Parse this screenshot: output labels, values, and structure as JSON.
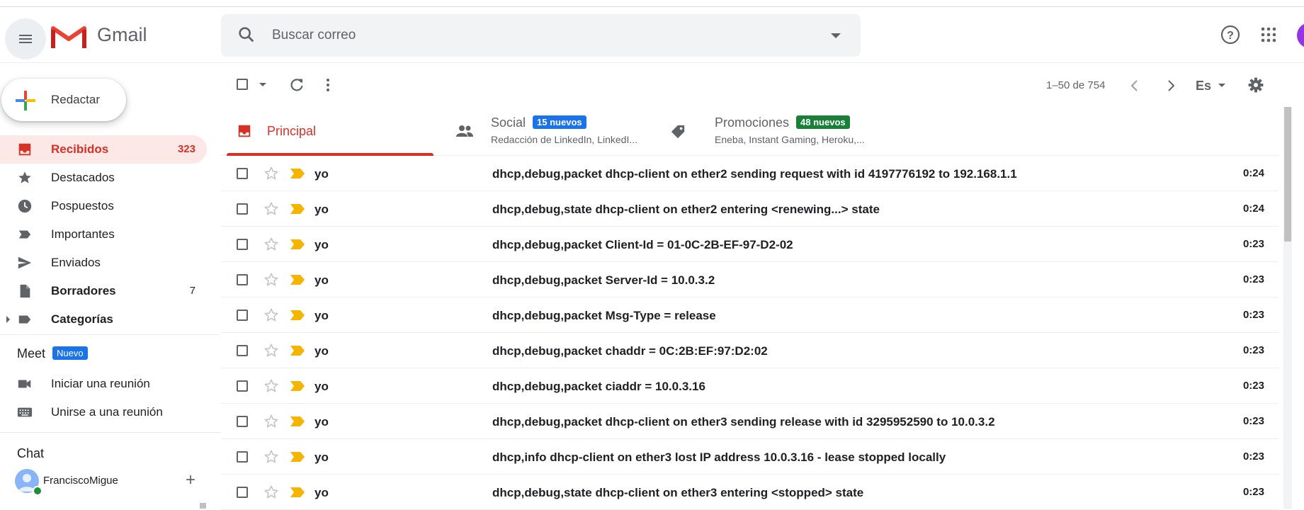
{
  "header": {
    "brand": "Gmail",
    "search_placeholder": "Buscar correo"
  },
  "sidebar": {
    "compose_label": "Redactar",
    "items": [
      {
        "label": "Recibidos",
        "count": "323",
        "icon": "inbox-icon"
      },
      {
        "label": "Destacados",
        "count": "",
        "icon": "star-icon"
      },
      {
        "label": "Pospuestos",
        "count": "",
        "icon": "clock-icon"
      },
      {
        "label": "Importantes",
        "count": "",
        "icon": "label-important-icon"
      },
      {
        "label": "Enviados",
        "count": "",
        "icon": "send-icon"
      },
      {
        "label": "Borradores",
        "count": "7",
        "icon": "draft-icon"
      },
      {
        "label": "Categorías",
        "count": "",
        "icon": "label-icon"
      }
    ],
    "meet": {
      "title": "Meet",
      "badge": "Nuevo",
      "items": [
        {
          "label": "Iniciar una reunión",
          "icon": "video-icon"
        },
        {
          "label": "Unirse a una reunión",
          "icon": "keyboard-icon"
        }
      ]
    },
    "chat": {
      "title": "Chat",
      "user": "FranciscoMigue"
    }
  },
  "toolbar": {
    "pager": "1–50 de 754",
    "language": "Es"
  },
  "tabs": [
    {
      "title": "Principal",
      "chip": "",
      "subtitle": ""
    },
    {
      "title": "Social",
      "chip": "15 nuevos",
      "subtitle": "Redacción de LinkedIn, LinkedI..."
    },
    {
      "title": "Promociones",
      "chip": "48 nuevos",
      "subtitle": "Eneba, Instant Gaming, Heroku,..."
    }
  ],
  "colors": {
    "accent_red": "#d93025",
    "social_chip": "#1a73e8",
    "promo_chip": "#188038",
    "important_marker": "#f4b400"
  },
  "emails": [
    {
      "sender": "yo",
      "subject": "dhcp,debug,packet dhcp-client on ether2 sending request with id 4197776192 to 192.168.1.1",
      "time": "0:24"
    },
    {
      "sender": "yo",
      "subject": "dhcp,debug,state dhcp-client on ether2 entering <renewing...> state",
      "time": "0:24"
    },
    {
      "sender": "yo",
      "subject": "dhcp,debug,packet Client-Id = 01-0C-2B-EF-97-D2-02",
      "time": "0:23"
    },
    {
      "sender": "yo",
      "subject": "dhcp,debug,packet Server-Id = 10.0.3.2",
      "time": "0:23"
    },
    {
      "sender": "yo",
      "subject": "dhcp,debug,packet Msg-Type = release",
      "time": "0:23"
    },
    {
      "sender": "yo",
      "subject": "dhcp,debug,packet chaddr = 0C:2B:EF:97:D2:02",
      "time": "0:23"
    },
    {
      "sender": "yo",
      "subject": "dhcp,debug,packet ciaddr = 10.0.3.16",
      "time": "0:23"
    },
    {
      "sender": "yo",
      "subject": "dhcp,debug,packet dhcp-client on ether3 sending release with id 3295952590 to 10.0.3.2",
      "time": "0:23"
    },
    {
      "sender": "yo",
      "subject": "dhcp,info dhcp-client on ether3 lost IP address 10.0.3.16 - lease stopped locally",
      "time": "0:23"
    },
    {
      "sender": "yo",
      "subject": "dhcp,debug,state dhcp-client on ether3 entering <stopped> state",
      "time": "0:23"
    }
  ]
}
